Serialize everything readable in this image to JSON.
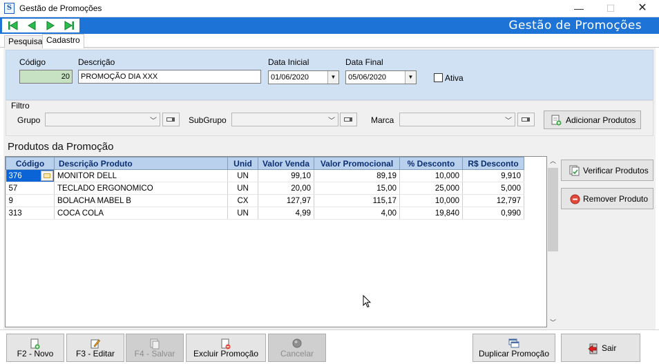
{
  "window": {
    "title": "Gestão de Promoções",
    "app_icon_letter": "S",
    "minimize_glyph": "—",
    "maximize_glyph": "☐",
    "close_glyph": "✕"
  },
  "header": {
    "title": "Gestão de Promoções",
    "bar_color": "#1e73d7",
    "nav_icons": [
      "first-record-icon",
      "previous-record-icon",
      "next-record-icon",
      "last-record-icon"
    ]
  },
  "tabs": [
    {
      "label": "Pesquisa",
      "active": false
    },
    {
      "label": "Cadastro",
      "active": true
    }
  ],
  "form": {
    "codigo_label": "Código",
    "codigo_value": "20",
    "descricao_label": "Descrição",
    "descricao_value": "PROMOÇÃO DIA XXX",
    "data_inicial_label": "Data Inicial",
    "data_inicial_value": "01/06/2020",
    "data_final_label": "Data Final",
    "data_final_value": "05/06/2020",
    "ativa_label": "Ativa",
    "ativa_checked": false
  },
  "filtro": {
    "title": "Filtro",
    "grupo_label": "Grupo",
    "grupo_value": "",
    "subgrupo_label": "SubGrupo",
    "subgrupo_value": "",
    "marca_label": "Marca",
    "marca_value": "",
    "add_button_label": "Adicionar Produtos"
  },
  "products": {
    "section_title": "Produtos da Promoção",
    "columns": [
      "Código",
      "Descrição Produto",
      "Unid",
      "Valor Venda",
      "Valor Promocional",
      "% Desconto",
      "R$ Desconto"
    ],
    "rows": [
      {
        "codigo": "376",
        "descricao": "MONITOR DELL",
        "unid": "UN",
        "valor_venda": "99,10",
        "valor_promocional": "89,19",
        "pct_desconto": "10,000",
        "rs_desconto": "9,910"
      },
      {
        "codigo": "57",
        "descricao": "TECLADO ERGONOMICO",
        "unid": "UN",
        "valor_venda": "20,00",
        "valor_promocional": "15,00",
        "pct_desconto": "25,000",
        "rs_desconto": "5,000"
      },
      {
        "codigo": "9",
        "descricao": "BOLACHA MABEL B",
        "unid": "CX",
        "valor_venda": "127,97",
        "valor_promocional": "115,17",
        "pct_desconto": "10,000",
        "rs_desconto": "12,797"
      },
      {
        "codigo": "313",
        "descricao": "COCA COLA",
        "unid": "UN",
        "valor_venda": "4,99",
        "valor_promocional": "4,00",
        "pct_desconto": "19,840",
        "rs_desconto": "0,990"
      }
    ],
    "verificar_label": "Verificar Produtos",
    "remover_label": "Remover Produto"
  },
  "toolbar": {
    "novo_label": "F2 - Novo",
    "editar_label": "F3 - Editar",
    "salvar_label": "F4 - Salvar",
    "excluir_label": "Excluir Promoção",
    "cancelar_label": "Cancelar",
    "duplicar_label": "Duplicar Promoção",
    "sair_label": "Sair"
  }
}
